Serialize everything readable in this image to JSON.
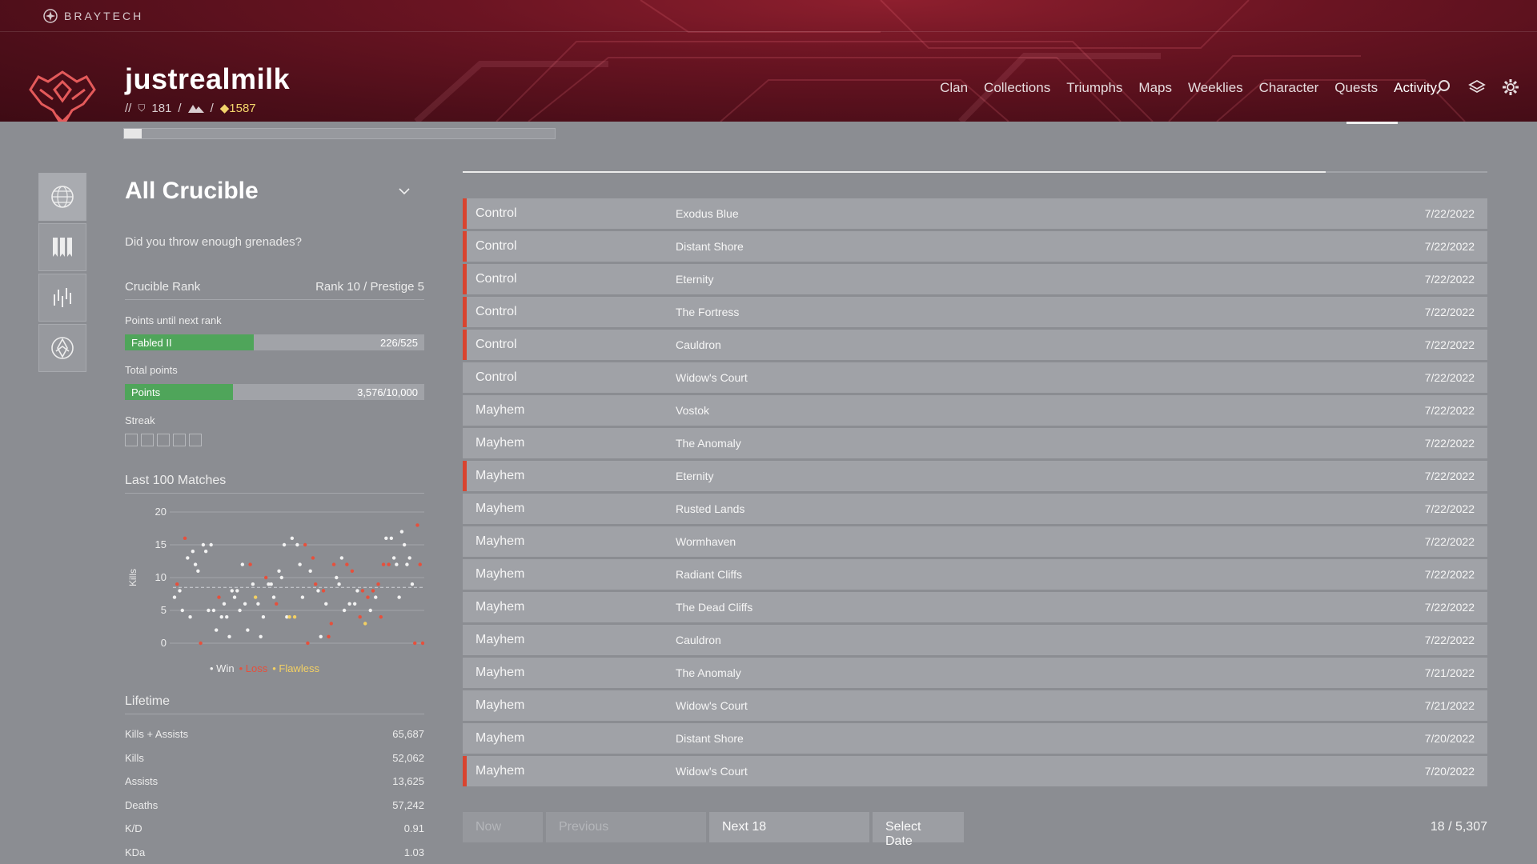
{
  "app": {
    "brand": "BRAYTECH"
  },
  "profile": {
    "username": "justrealmilk",
    "sep1": "//",
    "level": "181",
    "sep2": "/",
    "sep3": "/",
    "light": "1587"
  },
  "nav": {
    "items": [
      {
        "label": "Clan",
        "active": false
      },
      {
        "label": "Collections",
        "active": false
      },
      {
        "label": "Triumphs",
        "active": false
      },
      {
        "label": "Maps",
        "active": false
      },
      {
        "label": "Weeklies",
        "active": false
      },
      {
        "label": "Character",
        "active": false
      },
      {
        "label": "Quests",
        "active": false
      },
      {
        "label": "Activity",
        "active": true
      }
    ],
    "icons": [
      "search-icon",
      "layers-icon",
      "gear-icon"
    ]
  },
  "top_progress": {
    "fraction": 0.04
  },
  "rail": [
    "globe-icon",
    "banners-icon",
    "crucible-icon",
    "gambit-icon"
  ],
  "crucible": {
    "title": "All Crucible",
    "description": "Did you throw enough grenades?",
    "rank_label": "Crucible Rank",
    "rank_value": "Rank 10 / Prestige 5",
    "next_rank_label": "Points until next rank",
    "next_rank_bar": {
      "label": "Fabled II",
      "value_text": "226/525",
      "fraction": 0.43
    },
    "total_points_label": "Total points",
    "total_points_bar": {
      "label": "Points",
      "value_text": "3,576/10,000",
      "fraction": 0.36
    },
    "streak_label": "Streak",
    "streak_count": 5,
    "matches_title": "Last 100 Matches",
    "legend": {
      "win": "Win",
      "loss": "Loss",
      "flawless": "Flawless"
    },
    "lifetime_title": "Lifetime",
    "lifetime": [
      {
        "label": "Kills + Assists",
        "value": "65,687"
      },
      {
        "label": "Kills",
        "value": "52,062"
      },
      {
        "label": "Assists",
        "value": "13,625"
      },
      {
        "label": "Deaths",
        "value": "57,242"
      },
      {
        "label": "K/D",
        "value": "0.91"
      },
      {
        "label": "KDa",
        "value": "1.03"
      }
    ]
  },
  "chart_data": {
    "type": "scatter",
    "ylabel": "Kills",
    "ylim": [
      0,
      20
    ],
    "yticks": [
      0,
      5,
      10,
      15,
      20
    ],
    "average": 8.5,
    "colors": {
      "win": "#f2f2f2",
      "loss": "#e6503c",
      "flawless": "#f3d063"
    },
    "points": [
      {
        "x": 1,
        "y": 7,
        "r": "win"
      },
      {
        "x": 2,
        "y": 9,
        "r": "loss"
      },
      {
        "x": 3,
        "y": 8,
        "r": "win"
      },
      {
        "x": 4,
        "y": 5,
        "r": "win"
      },
      {
        "x": 5,
        "y": 16,
        "r": "loss"
      },
      {
        "x": 6,
        "y": 13,
        "r": "win"
      },
      {
        "x": 7,
        "y": 4,
        "r": "win"
      },
      {
        "x": 8,
        "y": 14,
        "r": "win"
      },
      {
        "x": 9,
        "y": 12,
        "r": "win"
      },
      {
        "x": 10,
        "y": 11,
        "r": "win"
      },
      {
        "x": 11,
        "y": 0,
        "r": "loss"
      },
      {
        "x": 12,
        "y": 15,
        "r": "win"
      },
      {
        "x": 13,
        "y": 14,
        "r": "win"
      },
      {
        "x": 14,
        "y": 5,
        "r": "win"
      },
      {
        "x": 15,
        "y": 15,
        "r": "win"
      },
      {
        "x": 16,
        "y": 5,
        "r": "win"
      },
      {
        "x": 17,
        "y": 2,
        "r": "win"
      },
      {
        "x": 18,
        "y": 7,
        "r": "loss"
      },
      {
        "x": 19,
        "y": 4,
        "r": "win"
      },
      {
        "x": 20,
        "y": 6,
        "r": "win"
      },
      {
        "x": 21,
        "y": 4,
        "r": "win"
      },
      {
        "x": 22,
        "y": 1,
        "r": "win"
      },
      {
        "x": 23,
        "y": 8,
        "r": "win"
      },
      {
        "x": 24,
        "y": 7,
        "r": "win"
      },
      {
        "x": 25,
        "y": 8,
        "r": "win"
      },
      {
        "x": 26,
        "y": 5,
        "r": "win"
      },
      {
        "x": 27,
        "y": 12,
        "r": "win"
      },
      {
        "x": 28,
        "y": 6,
        "r": "win"
      },
      {
        "x": 29,
        "y": 2,
        "r": "win"
      },
      {
        "x": 30,
        "y": 12,
        "r": "loss"
      },
      {
        "x": 31,
        "y": 9,
        "r": "win"
      },
      {
        "x": 32,
        "y": 7,
        "r": "flawless"
      },
      {
        "x": 33,
        "y": 6,
        "r": "win"
      },
      {
        "x": 34,
        "y": 1,
        "r": "win"
      },
      {
        "x": 35,
        "y": 4,
        "r": "win"
      },
      {
        "x": 36,
        "y": 10,
        "r": "loss"
      },
      {
        "x": 37,
        "y": 9,
        "r": "win"
      },
      {
        "x": 38,
        "y": 9,
        "r": "win"
      },
      {
        "x": 39,
        "y": 7,
        "r": "win"
      },
      {
        "x": 40,
        "y": 6,
        "r": "loss"
      },
      {
        "x": 41,
        "y": 11,
        "r": "win"
      },
      {
        "x": 42,
        "y": 10,
        "r": "win"
      },
      {
        "x": 43,
        "y": 15,
        "r": "win"
      },
      {
        "x": 44,
        "y": 4,
        "r": "win"
      },
      {
        "x": 45,
        "y": 4,
        "r": "flawless"
      },
      {
        "x": 46,
        "y": 16,
        "r": "win"
      },
      {
        "x": 47,
        "y": 4,
        "r": "flawless"
      },
      {
        "x": 48,
        "y": 15,
        "r": "win"
      },
      {
        "x": 49,
        "y": 12,
        "r": "win"
      },
      {
        "x": 50,
        "y": 7,
        "r": "win"
      },
      {
        "x": 51,
        "y": 15,
        "r": "loss"
      },
      {
        "x": 52,
        "y": 0,
        "r": "loss"
      },
      {
        "x": 53,
        "y": 11,
        "r": "win"
      },
      {
        "x": 54,
        "y": 13,
        "r": "loss"
      },
      {
        "x": 55,
        "y": 9,
        "r": "loss"
      },
      {
        "x": 56,
        "y": 8,
        "r": "win"
      },
      {
        "x": 57,
        "y": 1,
        "r": "win"
      },
      {
        "x": 58,
        "y": 8,
        "r": "loss"
      },
      {
        "x": 59,
        "y": 6,
        "r": "win"
      },
      {
        "x": 60,
        "y": 1,
        "r": "loss"
      },
      {
        "x": 61,
        "y": 3,
        "r": "loss"
      },
      {
        "x": 62,
        "y": 12,
        "r": "loss"
      },
      {
        "x": 63,
        "y": 10,
        "r": "win"
      },
      {
        "x": 64,
        "y": 9,
        "r": "win"
      },
      {
        "x": 65,
        "y": 13,
        "r": "win"
      },
      {
        "x": 66,
        "y": 5,
        "r": "win"
      },
      {
        "x": 67,
        "y": 12,
        "r": "loss"
      },
      {
        "x": 68,
        "y": 6,
        "r": "win"
      },
      {
        "x": 69,
        "y": 11,
        "r": "loss"
      },
      {
        "x": 70,
        "y": 6,
        "r": "win"
      },
      {
        "x": 71,
        "y": 8,
        "r": "win"
      },
      {
        "x": 72,
        "y": 4,
        "r": "loss"
      },
      {
        "x": 73,
        "y": 8,
        "r": "loss"
      },
      {
        "x": 74,
        "y": 3,
        "r": "flawless"
      },
      {
        "x": 75,
        "y": 7,
        "r": "loss"
      },
      {
        "x": 76,
        "y": 5,
        "r": "win"
      },
      {
        "x": 77,
        "y": 8,
        "r": "loss"
      },
      {
        "x": 78,
        "y": 7,
        "r": "win"
      },
      {
        "x": 79,
        "y": 9,
        "r": "loss"
      },
      {
        "x": 80,
        "y": 4,
        "r": "loss"
      },
      {
        "x": 81,
        "y": 12,
        "r": "loss"
      },
      {
        "x": 82,
        "y": 16,
        "r": "win"
      },
      {
        "x": 83,
        "y": 12,
        "r": "loss"
      },
      {
        "x": 84,
        "y": 16,
        "r": "win"
      },
      {
        "x": 85,
        "y": 13,
        "r": "win"
      },
      {
        "x": 86,
        "y": 12,
        "r": "win"
      },
      {
        "x": 87,
        "y": 7,
        "r": "win"
      },
      {
        "x": 88,
        "y": 17,
        "r": "win"
      },
      {
        "x": 89,
        "y": 15,
        "r": "win"
      },
      {
        "x": 90,
        "y": 12,
        "r": "win"
      },
      {
        "x": 91,
        "y": 13,
        "r": "win"
      },
      {
        "x": 92,
        "y": 9,
        "r": "win"
      },
      {
        "x": 93,
        "y": 0,
        "r": "loss"
      },
      {
        "x": 94,
        "y": 18,
        "r": "loss"
      },
      {
        "x": 95,
        "y": 12,
        "r": "loss"
      },
      {
        "x": 96,
        "y": 0,
        "r": "loss"
      }
    ]
  },
  "activities": [
    {
      "mode": "Control",
      "map": "Exodus Blue",
      "date": "7/22/2022",
      "loss": true
    },
    {
      "mode": "Control",
      "map": "Distant Shore",
      "date": "7/22/2022",
      "loss": true
    },
    {
      "mode": "Control",
      "map": "Eternity",
      "date": "7/22/2022",
      "loss": true
    },
    {
      "mode": "Control",
      "map": "The Fortress",
      "date": "7/22/2022",
      "loss": true
    },
    {
      "mode": "Control",
      "map": "Cauldron",
      "date": "7/22/2022",
      "loss": true
    },
    {
      "mode": "Control",
      "map": "Widow's Court",
      "date": "7/22/2022",
      "loss": false
    },
    {
      "mode": "Mayhem",
      "map": "Vostok",
      "date": "7/22/2022",
      "loss": false
    },
    {
      "mode": "Mayhem",
      "map": "The Anomaly",
      "date": "7/22/2022",
      "loss": false
    },
    {
      "mode": "Mayhem",
      "map": "Eternity",
      "date": "7/22/2022",
      "loss": true
    },
    {
      "mode": "Mayhem",
      "map": "Rusted Lands",
      "date": "7/22/2022",
      "loss": false
    },
    {
      "mode": "Mayhem",
      "map": "Wormhaven",
      "date": "7/22/2022",
      "loss": false
    },
    {
      "mode": "Mayhem",
      "map": "Radiant Cliffs",
      "date": "7/22/2022",
      "loss": false
    },
    {
      "mode": "Mayhem",
      "map": "The Dead Cliffs",
      "date": "7/22/2022",
      "loss": false
    },
    {
      "mode": "Mayhem",
      "map": "Cauldron",
      "date": "7/22/2022",
      "loss": false
    },
    {
      "mode": "Mayhem",
      "map": "The Anomaly",
      "date": "7/21/2022",
      "loss": false
    },
    {
      "mode": "Mayhem",
      "map": "Widow's Court",
      "date": "7/21/2022",
      "loss": false
    },
    {
      "mode": "Mayhem",
      "map": "Distant Shore",
      "date": "7/20/2022",
      "loss": false
    },
    {
      "mode": "Mayhem",
      "map": "Widow's Court",
      "date": "7/20/2022",
      "loss": true
    }
  ],
  "pager": {
    "now": "Now",
    "previous": "Previous",
    "next": "Next 18",
    "select_date": "Select Date",
    "count": "18 / 5,307"
  }
}
